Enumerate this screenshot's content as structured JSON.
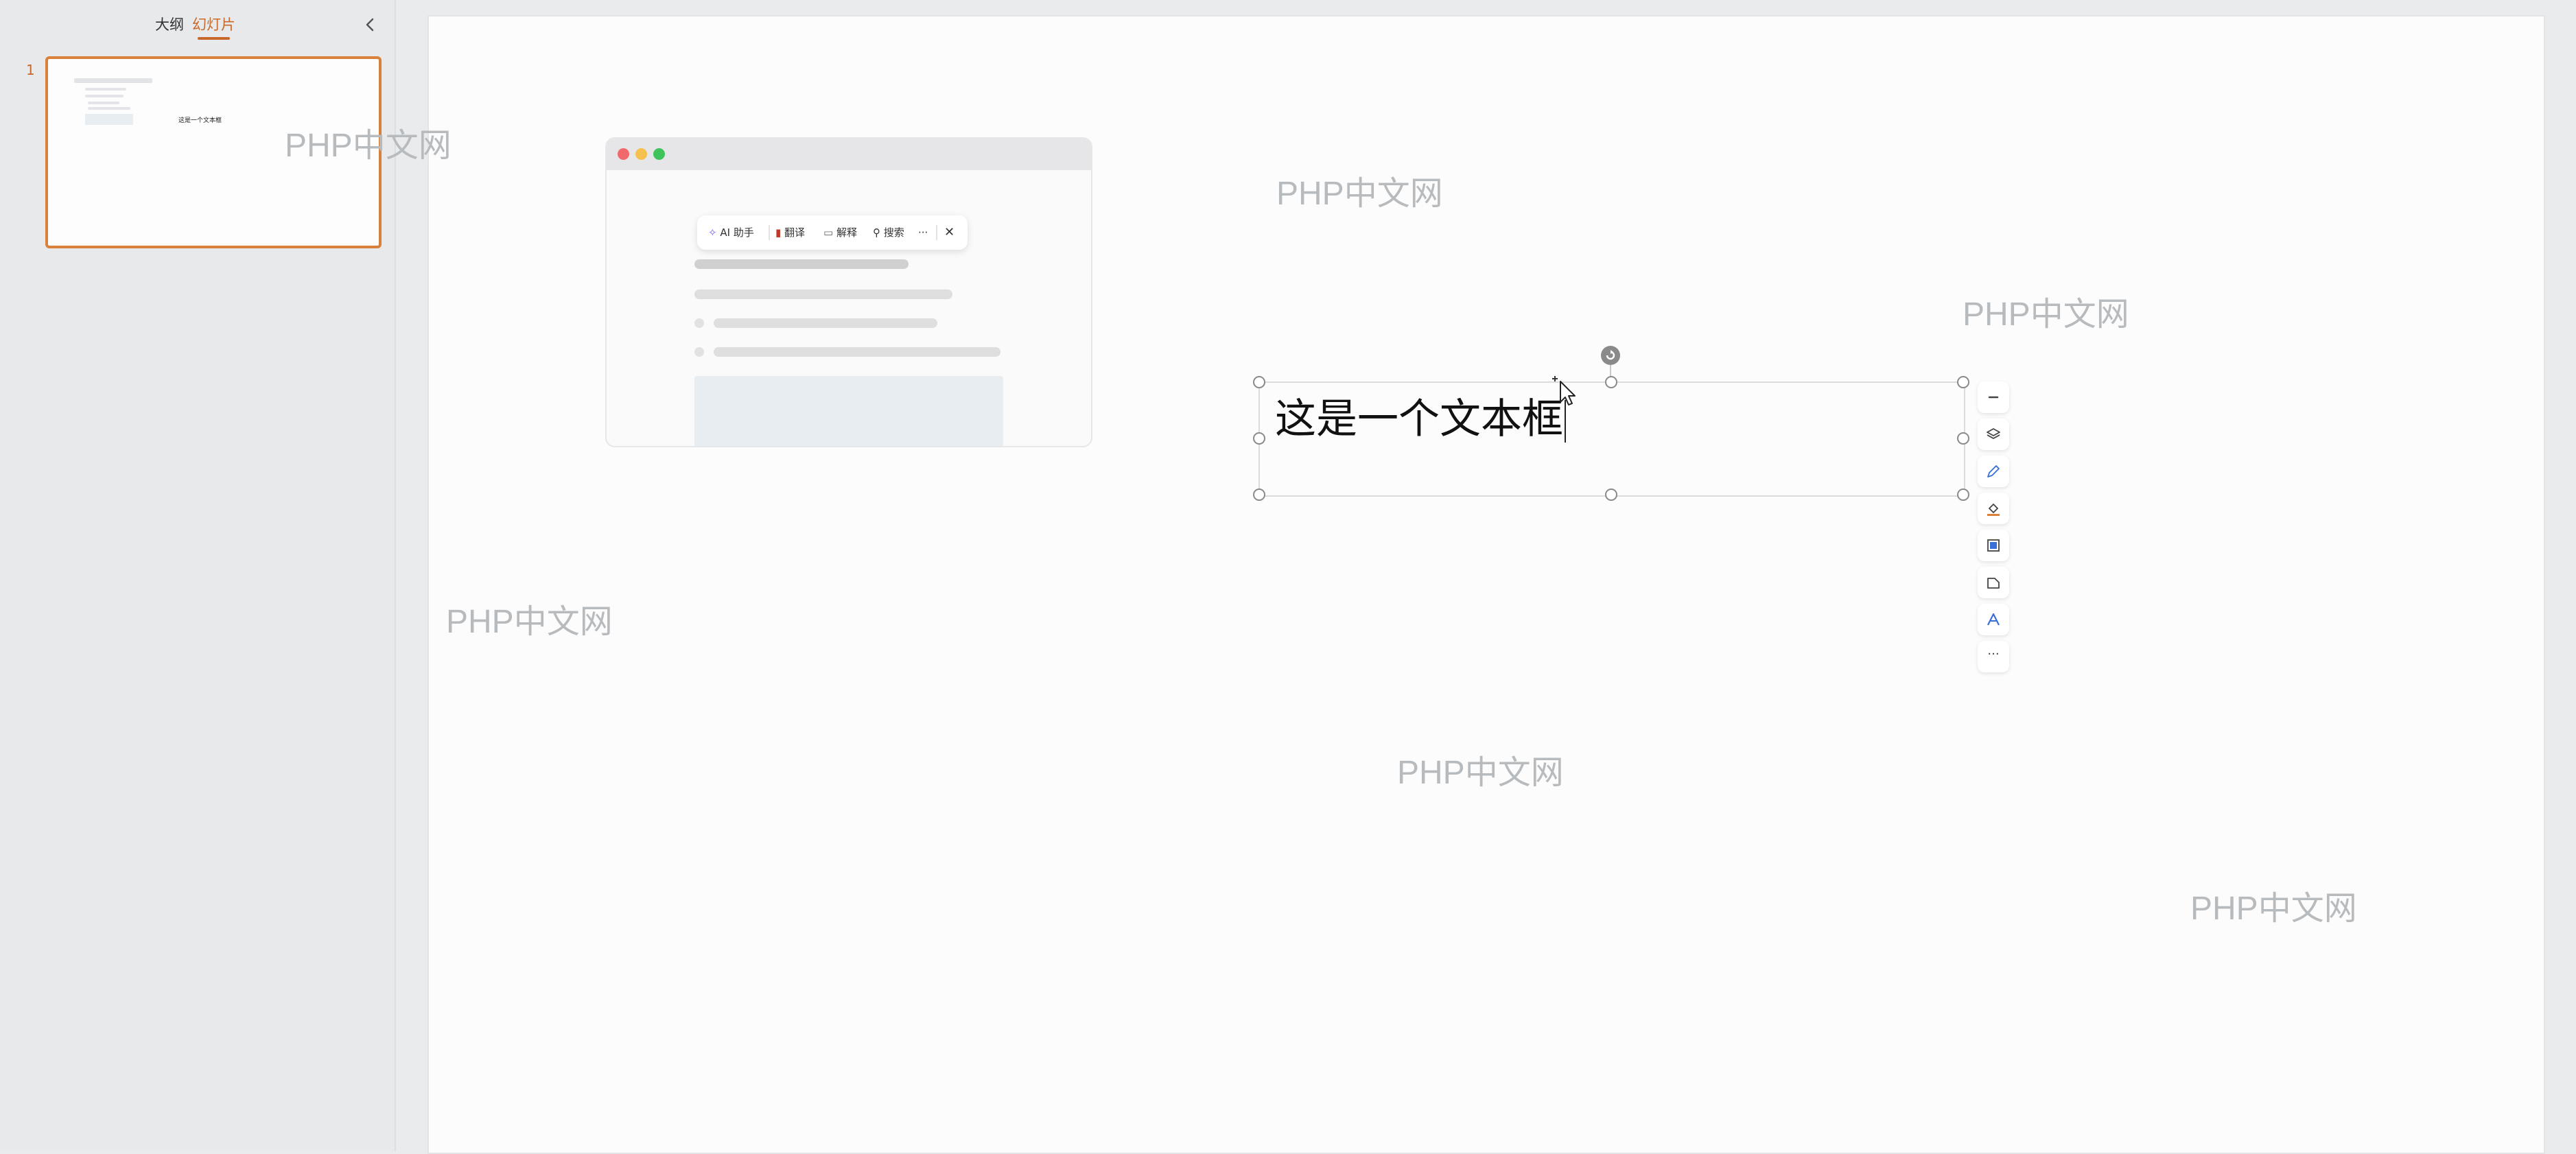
{
  "sidebar": {
    "tabs": [
      {
        "label": "大纲"
      },
      {
        "label": "幻灯片"
      }
    ],
    "slides": [
      {
        "number": "1",
        "thumbnail_text": "这是一个文本框"
      }
    ]
  },
  "canvas": {
    "embedded_window": {
      "toolbar": {
        "ai_label": "AI 助手",
        "translate_label": "翻译",
        "explain_label": "解释",
        "search_label": "搜索",
        "more_label": "···",
        "close_label": "✕"
      }
    },
    "text_box": {
      "text": "这是一个文本框"
    },
    "side_tools": {
      "more_label": "···"
    },
    "watermark": "PHP中文网"
  },
  "colors": {
    "accent": "#c8692b",
    "selection_border": "#d9813b"
  }
}
